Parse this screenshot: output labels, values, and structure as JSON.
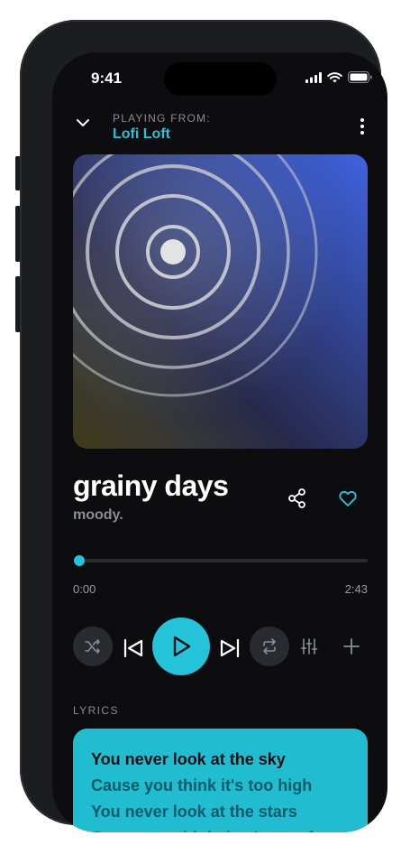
{
  "status": {
    "time": "9:41"
  },
  "header": {
    "playing_from_label": "PLAYING FROM:",
    "source_name": "Lofi Loft"
  },
  "track": {
    "title": "grainy days",
    "artist": "moody.",
    "progress": 0.0,
    "elapsed": "0:00",
    "duration": "2:43"
  },
  "colors": {
    "accent": "#25c3d9",
    "background": "#0d0d10",
    "lyrics_card": "#22bcd1"
  },
  "controls": [
    "shuffle-icon",
    "previous-icon",
    "play-icon",
    "next-icon",
    "repeat-icon",
    "equalizer-icon",
    "add-icon"
  ],
  "lyrics": {
    "label": "LYRICS",
    "lines": [
      "You never look at the sky",
      "Cause you think it's too high",
      "You never look at the stars",
      "Cause you think they're too far"
    ]
  }
}
